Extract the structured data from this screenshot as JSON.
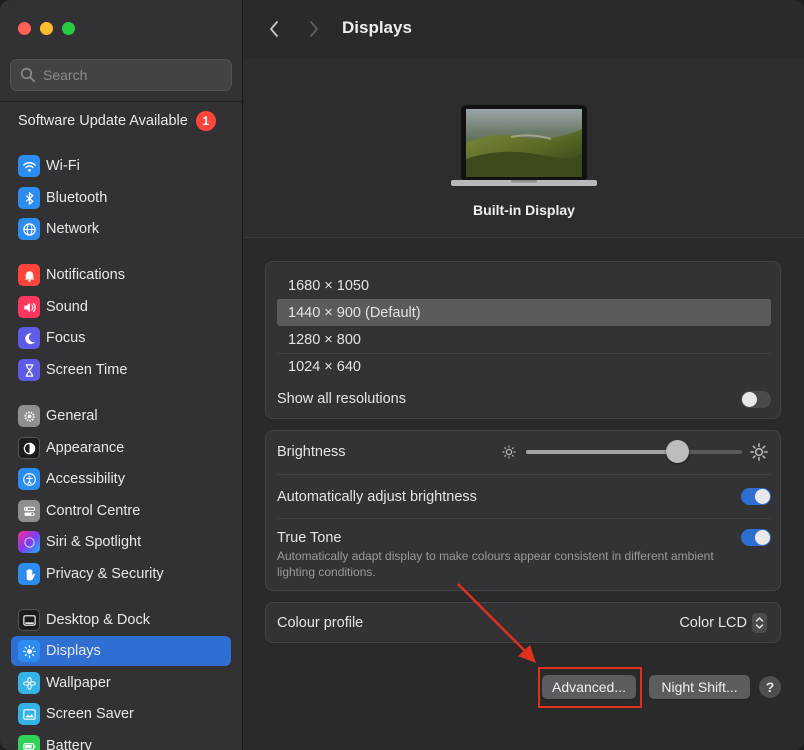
{
  "search": {
    "placeholder": "Search"
  },
  "update": {
    "label": "Software Update Available",
    "badge": "1"
  },
  "sidebar": {
    "items": [
      {
        "label": "Wi-Fi",
        "icon": "wifi-icon",
        "color": "#2d8cf0"
      },
      {
        "label": "Bluetooth",
        "icon": "bluetooth-icon",
        "color": "#2d8cf0"
      },
      {
        "label": "Network",
        "icon": "globe-icon",
        "color": "#2d8cf0"
      },
      {
        "label": "Notifications",
        "icon": "bell-icon",
        "color": "#ff453a"
      },
      {
        "label": "Sound",
        "icon": "speaker-icon",
        "color": "#ff375f"
      },
      {
        "label": "Focus",
        "icon": "moon-icon",
        "color": "#5e5ce6"
      },
      {
        "label": "Screen Time",
        "icon": "hourglass-icon",
        "color": "#5e5ce6"
      },
      {
        "label": "General",
        "icon": "gear-icon",
        "color": "#8e8e93"
      },
      {
        "label": "Appearance",
        "icon": "appearance-icon",
        "color": "#1c1c1e"
      },
      {
        "label": "Accessibility",
        "icon": "accessibility-icon",
        "color": "#2d8cf0"
      },
      {
        "label": "Control Centre",
        "icon": "control-centre-icon",
        "color": "#8e8e93"
      },
      {
        "label": "Siri & Spotlight",
        "icon": "siri-icon",
        "color": "#7d3cf0"
      },
      {
        "label": "Privacy & Security",
        "icon": "hand-icon",
        "color": "#2d8cf0"
      },
      {
        "label": "Desktop & Dock",
        "icon": "dock-icon",
        "color": "#1c1c1e"
      },
      {
        "label": "Displays",
        "icon": "sun-icon",
        "color": "#2d8cf0"
      },
      {
        "label": "Wallpaper",
        "icon": "flower-icon",
        "color": "#36b3e6"
      },
      {
        "label": "Screen Saver",
        "icon": "screen-saver-icon",
        "color": "#36b3e6"
      },
      {
        "label": "Battery",
        "icon": "battery-icon",
        "color": "#30d158"
      }
    ],
    "selected": "Displays"
  },
  "header": {
    "title": "Displays"
  },
  "display": {
    "name": "Built-in Display"
  },
  "resolutions": {
    "options": [
      "1680 × 1050",
      "1440 × 900 (Default)",
      "1280 × 800",
      "1024 × 640"
    ],
    "selected_index": 1,
    "show_all_label": "Show all resolutions",
    "show_all_enabled": false
  },
  "brightness": {
    "label": "Brightness",
    "value": 0.7,
    "auto_label": "Automatically adjust brightness",
    "auto_enabled": true,
    "true_tone_label": "True Tone",
    "true_tone_desc": "Automatically adapt display to make colours appear consistent in different ambient lighting conditions.",
    "true_tone_enabled": true
  },
  "colour_profile": {
    "label": "Colour profile",
    "value": "Color LCD"
  },
  "buttons": {
    "advanced": "Advanced...",
    "night_shift": "Night Shift...",
    "help": "?"
  },
  "colors": {
    "accent": "#2f6fd1",
    "annotation": "#e0301e"
  }
}
